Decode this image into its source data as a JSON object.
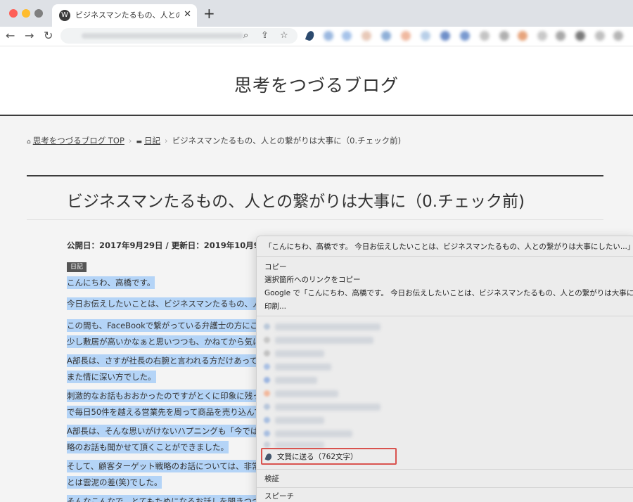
{
  "browser": {
    "tab_title": "ビジネスマンたるもの、人との繋が",
    "tab_close": "✕",
    "new_tab": "+"
  },
  "site": {
    "title": "思考をつづるブログ"
  },
  "breadcrumb": {
    "home": "思考をつづるブログ TOP",
    "category": "日記",
    "current": "ビジネスマンたるもの、人との繋がりは大事に（0.チェック前)"
  },
  "article": {
    "title": "ビジネスマンたるもの、人との繋がりは大事に（0.チェック前)",
    "dates": "公開日：2017年9月29日 / 更新日：2019年10月9日",
    "category_badge": "日記",
    "paragraphs": [
      [
        "こんにちわ、高橋です。"
      ],
      [
        "今日お伝えしたいことは、ビジネスマンたるもの、人との"
      ],
      [
        "この間も、FaceBookで繋がっている弁護士の方にご紹",
        "少し敷居が高いかなぁと思いつつも、かねてから気にな"
      ],
      [
        "A部長は、さすが社長の右腕と言われる方だけあって、",
        "また情に深い方でした。"
      ],
      [
        "刺激的なお話もおおかったのですがとくに印象に残っ",
        "で毎日50件を越える営業先を周って商品を売り込んでい"
      ],
      [
        "A部長は、そんな思いがけないハプニングも「今では良",
        "略のお話も聞かせて頂くことができました。"
      ],
      [
        "そして、顧客ターゲット戦略のお話については、非常に",
        "とは雲泥の差(笑)でした。"
      ],
      [
        "そんなこんなで、とてもためになるお話しを聞きつつ"
      ]
    ]
  },
  "context_menu": {
    "search_item": "「こんにちわ、高橋です。 今日お伝えしたいことは、ビジネスマンたるもの、人との繋がりは大事にしたい...」を",
    "copy": "コピー",
    "copy_link": "選択箇所へのリンクをコピー",
    "google_search": "Google で「こんにちわ、高橋です。 今日お伝えしたいことは、ビジネスマンたるもの、人との繋がりは大事にし",
    "print": "印刷...",
    "bunsho": "文賢に送る（762文字）",
    "inspect": "検証",
    "speech": "スピーチ"
  }
}
